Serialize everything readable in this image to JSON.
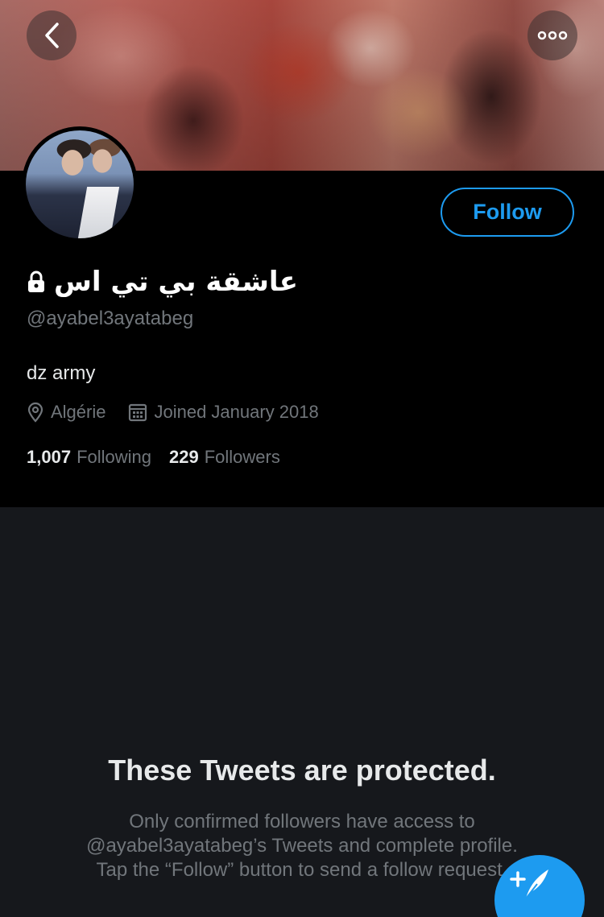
{
  "header": {
    "back_icon": "chevron-left-icon",
    "more_icon": "more-horizontal-icon"
  },
  "profile": {
    "display_name": "عاشقة بي تي اس",
    "lock_icon": "lock-icon",
    "handle": "@ayabel3ayatabeg",
    "bio": "dz army",
    "location": "Algérie",
    "joined": "Joined January 2018",
    "following_count": "1,007",
    "following_label": "Following",
    "followers_count": "229",
    "followers_label": "Followers",
    "follow_label": "Follow"
  },
  "protected": {
    "title": "These Tweets are protected.",
    "line1": "Only confirmed followers have access to",
    "line2": "@ayabel3ayatabeg’s Tweets and complete profile.",
    "line3": "Tap the “Follow” button to send a follow request."
  },
  "fab": {
    "icon": "compose-tweet-icon"
  },
  "colors": {
    "accent": "#1d9bf0",
    "header_bg": "#000000",
    "body_bg": "#16181c",
    "secondary_text": "#71767b"
  }
}
